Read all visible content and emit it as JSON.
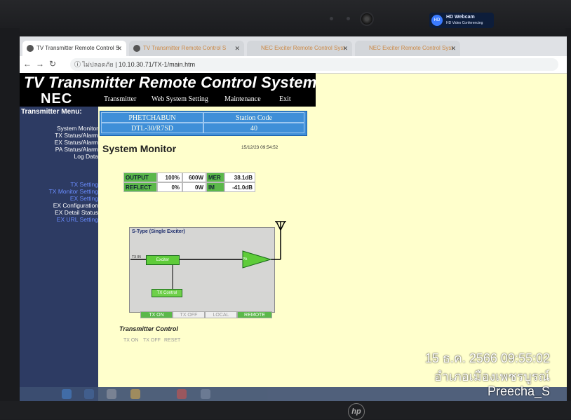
{
  "browser": {
    "tabs": [
      {
        "label": "TV Transmitter Remote Control S",
        "active": true
      },
      {
        "label": "TV Transmitter Remote Control S",
        "active": false
      },
      {
        "label": "NEC Exciter Remote Control Syst",
        "active": false
      },
      {
        "label": "NEC Exciter Remote Control Syst",
        "active": false
      }
    ],
    "security_label": "ไม่ปลอดภัย",
    "url": "10.10.30.71/TX-1/main.htm"
  },
  "webcam_badge": {
    "title": "HD Webcam",
    "subtitle": "HD Video Conferencing"
  },
  "header": {
    "title": "TV Transmitter Remote Control System",
    "logo": "NEC",
    "nav": [
      "Transmitter",
      "Web System Setting",
      "Maintenance",
      "Exit"
    ]
  },
  "sidebar": {
    "heading": "Transmitter Menu:",
    "group1": [
      "System Monitor",
      "TX Status/Alarm",
      "EX Status/Alarm",
      "PA Status/Alarm",
      "Log Data"
    ],
    "group2": [
      "TX Setting",
      "TX Monitor Setting",
      "EX Setting",
      "EX Configuration",
      "EX Detail Status",
      "EX URL Setting"
    ]
  },
  "station": {
    "name": "PHETCHABUN",
    "model": "DTL-30/R7SD",
    "code_label": "Station Code",
    "code": "40"
  },
  "monitor": {
    "title": "System Monitor",
    "timestamp": "15/12/23 09:54:52",
    "output_label": "OUTPUT",
    "output_pct": "100%",
    "output_power": "600W",
    "mer_label": "MER",
    "mer_value": "38.1dB",
    "reflect_label": "REFLECT",
    "reflect_pct": "0%",
    "reflect_power": "0W",
    "im_label": "IM",
    "im_value": "-41.0dB"
  },
  "diagram": {
    "title": "S-Type (Single Exciter)",
    "tx_in": "TX IN",
    "exciter": "Exciter",
    "pa": "PA",
    "tx_control": "TX Control"
  },
  "status_buttons": [
    {
      "label": "TX ON",
      "on": true
    },
    {
      "label": "TX OFF",
      "on": false
    },
    {
      "label": "LOCAL",
      "on": false
    },
    {
      "label": "REMOTE",
      "on": true
    }
  ],
  "transmitter_control": {
    "title": "Transmitter Control",
    "buttons": [
      "TX ON",
      "TX OFF",
      "RESET"
    ]
  },
  "overlay": {
    "datetime": "15 ธ.ค. 2566 09:55:02",
    "location": "อำเภอเมืองเพชรบูรณ์",
    "user": "Preecha_S"
  },
  "laptop_brand": "hp"
}
